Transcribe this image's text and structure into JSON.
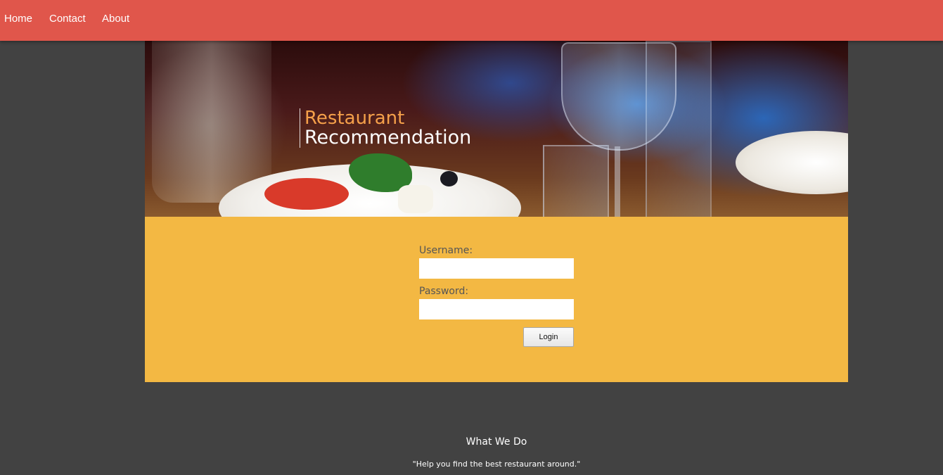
{
  "nav": {
    "items": [
      {
        "label": "Home"
      },
      {
        "label": "Contact"
      },
      {
        "label": "About"
      }
    ],
    "background": "#e0564b"
  },
  "hero": {
    "title_line1": "Restaurant",
    "title_line2": "Recommendation",
    "title_line1_color": "#f5a04a"
  },
  "login": {
    "username_label": "Username:",
    "username_value": "",
    "password_label": "Password:",
    "password_value": "",
    "button_label": "Login",
    "panel_color": "#f3b843"
  },
  "about_section": {
    "title": "What We Do",
    "quote": "\"Help you find the best restaurant around.\""
  },
  "page_background": "#424242"
}
